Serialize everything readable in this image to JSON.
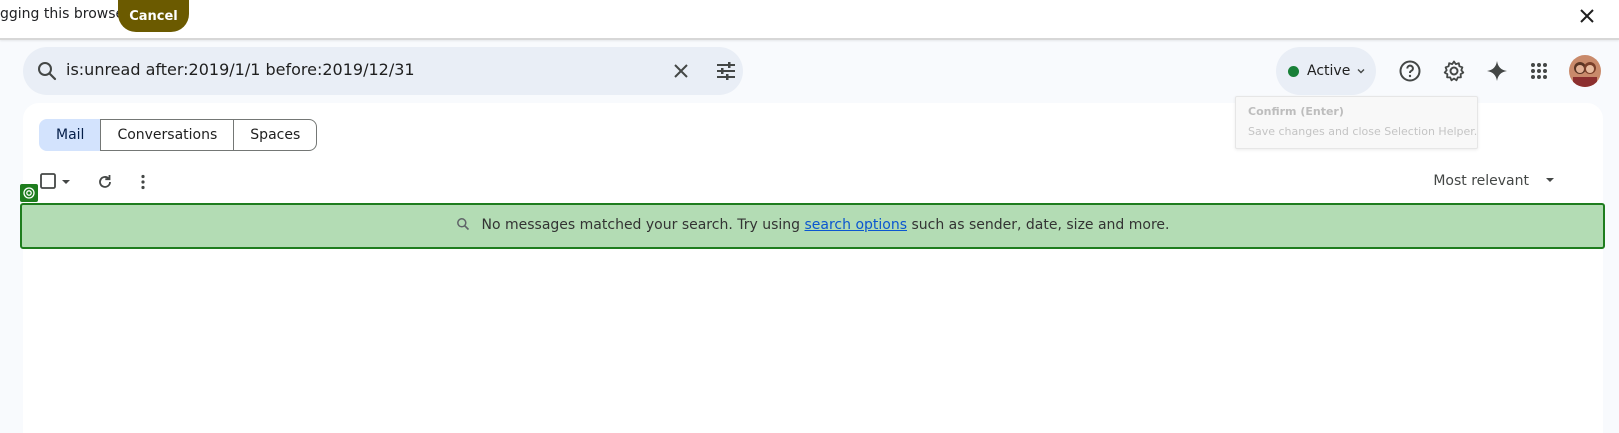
{
  "banner": {
    "message": "gging this browser",
    "cancel_label": "Cancel",
    "close_icon": "close-icon"
  },
  "search": {
    "query": "is:unread after:2019/1/1 before:2019/12/31",
    "icons": [
      "search-icon",
      "clear-icon",
      "tune-icon"
    ]
  },
  "header": {
    "status_label": "Active",
    "status_color": "#188038",
    "icons": [
      "help-icon",
      "settings-icon",
      "gemini-icon",
      "apps-icon"
    ]
  },
  "tooltip": {
    "title": "Confirm (Enter)",
    "description": "Save changes and close Selection Helper."
  },
  "tabs": [
    {
      "label": "Mail",
      "active": true
    },
    {
      "label": "Conversations",
      "active": false
    },
    {
      "label": "Spaces",
      "active": false
    }
  ],
  "toolbar": {
    "sort_label": "Most relevant"
  },
  "empty_state": {
    "text_before": "No messages matched your search. Try using ",
    "link_text": "search options",
    "text_after": " such as sender, date, size and more.",
    "highlight_color": "#b3dcb4"
  }
}
